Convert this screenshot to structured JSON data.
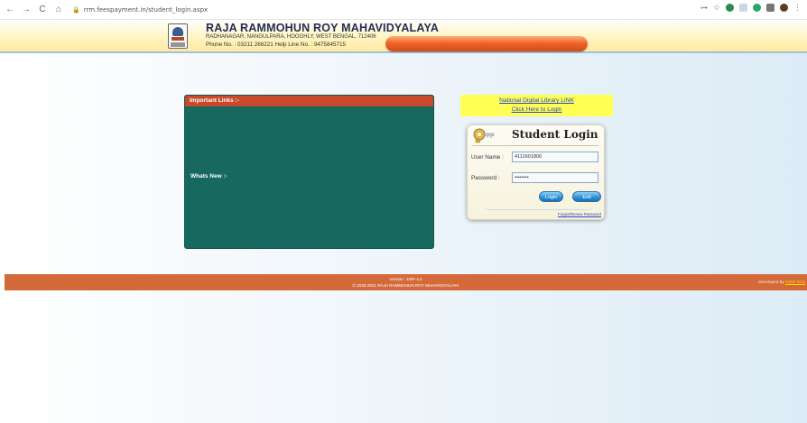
{
  "browser": {
    "back": "←",
    "forward": "→",
    "reload": "C",
    "home": "⌂",
    "url": "rrm.feespayment.in/student_login.aspx",
    "lock_icon": "lock-icon",
    "star": "☆",
    "key": "⊶"
  },
  "header": {
    "college_name": "RAJA RAMMOHUN ROY MAHAVIDYALAYA",
    "address": "RADHANAGAR, NANGULPARA, HOOGHLY, WEST BENGAL, 712406",
    "phone": "Phone No. : 03211 266221   Help Line No. : 9475845715",
    "bar_color": "#f0642a"
  },
  "links_panel": {
    "title": "Important Links :-",
    "whats_new": "Whats New :-",
    "color": "#17685f"
  },
  "ndl": {
    "title": "National Digital Library LINK",
    "link": "Click Here to Login"
  },
  "login": {
    "title": "Student Login",
    "username_label": "User Name :",
    "username_value": "4111601806",
    "password_label": "Password :",
    "password_value": "12345678",
    "login_button": "Login",
    "exit_button": "Exit",
    "forgot": "Forgot/Renew Password"
  },
  "footer": {
    "version": "Version : ERP 4.0",
    "copyright": "© 2020-2021  RAJA RAMMOHUN ROY MAHAVIDYALAYA",
    "developed_by": "Developed By ",
    "developer": "INDS Tech",
    "color": "#d46a39"
  }
}
